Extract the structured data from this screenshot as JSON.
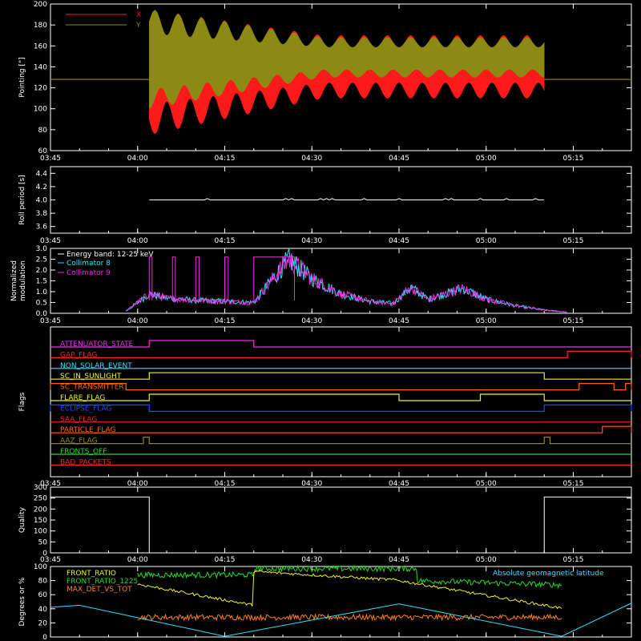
{
  "colors": {
    "background": "#000000",
    "axes": "#ffffff",
    "red": "#ff1a1a",
    "olive": "#8c8a14",
    "cyan": "#33e0ff",
    "magenta": "#e633e6",
    "white": "#ffffff",
    "green": "#22dd22",
    "yellow": "#f0f020",
    "orange": "#ff8020",
    "blue": "#2244ff",
    "darkorange": "#ff6600",
    "flagred": "#ff2020"
  },
  "time_axis": {
    "start": "03:45",
    "end": "05:25",
    "ticks": [
      "03:45",
      "04:00",
      "04:15",
      "04:30",
      "04:45",
      "05:00",
      "05:15"
    ]
  },
  "chart_data": [
    {
      "id": "pointing",
      "type": "line",
      "ylabel": "Pointing [\"]",
      "ylim": [
        60,
        200
      ],
      "yticks": [
        "60",
        "80",
        "100",
        "120",
        "140",
        "160",
        "180",
        "200"
      ],
      "legend": "top-left",
      "series": [
        {
          "name": "X",
          "color": "red",
          "baseline": 128,
          "active": [
            "04:02",
            "05:10"
          ],
          "envelope_early": [
            75,
            195
          ],
          "envelope_late": [
            110,
            170
          ]
        },
        {
          "name": "Y",
          "color": "olive",
          "baseline": 128,
          "active": [
            "04:02",
            "05:10"
          ],
          "envelope_early": [
            100,
            195
          ],
          "envelope_late": [
            130,
            168
          ]
        }
      ]
    },
    {
      "id": "roll",
      "type": "line",
      "ylabel": "Roll period [s]",
      "ylim": [
        3.5,
        4.5
      ],
      "yticks": [
        "3.6",
        "3.8",
        "4.0",
        "4.2",
        "4.4"
      ],
      "series": [
        {
          "color": "white",
          "value": 4.0
        }
      ]
    },
    {
      "id": "modulation",
      "type": "line",
      "ylabel": "Normalized modulation",
      "ylim": [
        0,
        3
      ],
      "yticks": [
        "0.0",
        "0.5",
        "1.0",
        "1.5",
        "2.0",
        "2.5",
        "3.0"
      ],
      "legend": "top-left",
      "legend_title": "Energy band: 12-25 keV",
      "series": [
        {
          "name": "Collimator 8",
          "color": "cyan"
        },
        {
          "name": "Collimator 9",
          "color": "magenta"
        }
      ],
      "profile_x": [
        "03:58",
        "04:02",
        "04:05",
        "04:10",
        "04:15",
        "04:20",
        "04:26",
        "04:30",
        "04:35",
        "04:40",
        "04:44",
        "04:47",
        "04:50",
        "04:53",
        "04:56",
        "05:00",
        "05:05",
        "05:10",
        "05:14"
      ],
      "profile_y": [
        0.1,
        0.9,
        0.7,
        0.6,
        0.55,
        0.5,
        2.5,
        1.6,
        0.9,
        0.55,
        0.45,
        1.2,
        0.65,
        0.9,
        1.15,
        0.65,
        0.35,
        0.15,
        0.05
      ]
    },
    {
      "id": "flags",
      "type": "table",
      "ylabel": "Flags",
      "rows": [
        {
          "name": "ATTENUATOR_STATE",
          "color": "magenta",
          "on": [
            [
              "04:02",
              "04:20"
            ]
          ]
        },
        {
          "name": "GAP_FLAG",
          "color": "flagred",
          "on": [
            [
              "05:14",
              "05:25"
            ]
          ]
        },
        {
          "name": "NON_SOLAR_EVENT",
          "color": "cyan",
          "on": []
        },
        {
          "name": "SC_IN_SUNLIGHT",
          "color": "yellow",
          "on": [
            [
              "04:02",
              "05:10"
            ]
          ]
        },
        {
          "name": "SC_TRANSMITTER",
          "color": "darkorange",
          "on": [
            [
              "03:45",
              "03:58"
            ],
            [
              "05:16",
              "05:22"
            ],
            [
              "05:24",
              "05:25"
            ]
          ]
        },
        {
          "name": "FLARE_FLAG",
          "color": "yellow",
          "on": [
            [
              "04:02",
              "04:45"
            ],
            [
              "04:59",
              "05:10"
            ]
          ]
        },
        {
          "name": "ECLIPSE_FLAG",
          "color": "blue",
          "on": [
            [
              "03:45",
              "04:02"
            ],
            [
              "05:10",
              "05:25"
            ]
          ]
        },
        {
          "name": "SAA_FLAG",
          "color": "flagred",
          "on": []
        },
        {
          "name": "PARTICLE_FLAG",
          "color": "darkorange",
          "on": [
            [
              "05:20",
              "05:25"
            ]
          ]
        },
        {
          "name": "AAZ_FLAG",
          "color": "olive",
          "on": [
            [
              "04:01",
              "04:02"
            ],
            [
              "05:10",
              "05:11"
            ]
          ]
        },
        {
          "name": "FRONTS_OFF",
          "color": "green",
          "on": []
        },
        {
          "name": "BAD_PACKETS",
          "color": "flagred",
          "on": []
        }
      ]
    },
    {
      "id": "quality",
      "type": "line",
      "ylabel": "Quality",
      "ylim": [
        0,
        300
      ],
      "yticks": [
        "0",
        "50",
        "100",
        "150",
        "200",
        "250",
        "300"
      ],
      "series": [
        {
          "color": "white",
          "x": [
            "03:45",
            "04:02",
            "04:02",
            "05:10",
            "05:10",
            "05:25"
          ],
          "y": [
            255,
            255,
            0,
            0,
            255,
            255
          ]
        }
      ]
    },
    {
      "id": "ratios",
      "type": "line",
      "ylabel": "Degrees or %",
      "ylim": [
        0,
        100
      ],
      "yticks": [
        "0",
        "20",
        "40",
        "60",
        "80",
        "100"
      ],
      "legend": "top-left",
      "series": [
        {
          "name": "FRONT_RATIO",
          "color": "yellow"
        },
        {
          "name": "FRONT_RATIO_1225",
          "color": "green"
        },
        {
          "name": "MAX_DET_VS_TOT",
          "color": "orange"
        },
        {
          "name": "Absolute geomagnetic latitude",
          "color": "cyan",
          "x": [
            "03:45",
            "03:50",
            "04:15",
            "04:45",
            "05:13",
            "05:25"
          ],
          "y": [
            42,
            45,
            1,
            47,
            1,
            48
          ]
        }
      ]
    }
  ]
}
